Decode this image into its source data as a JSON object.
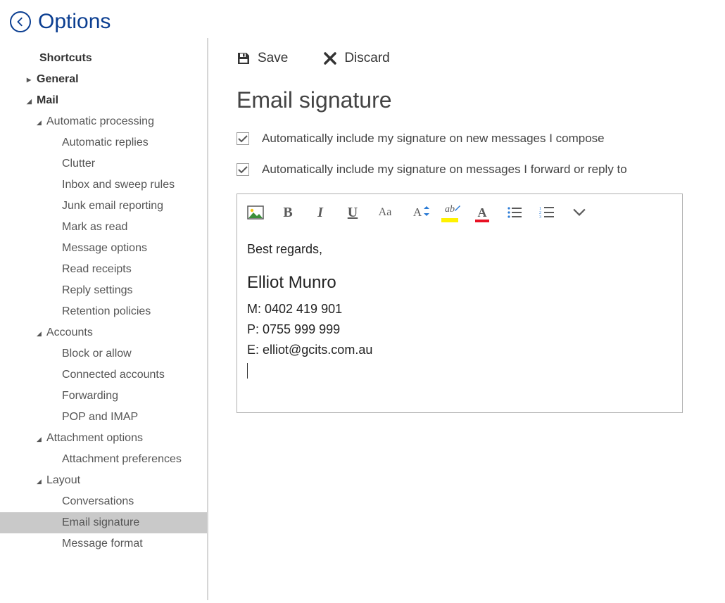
{
  "header": {
    "title": "Options"
  },
  "toolbar": {
    "save": "Save",
    "discard": "Discard"
  },
  "section": {
    "heading": "Email signature"
  },
  "checkboxes": {
    "compose": "Automatically include my signature on new messages I compose",
    "reply": "Automatically include my signature on messages I forward or reply to"
  },
  "signature": {
    "greeting": "Best regards,",
    "name": "Elliot Munro",
    "mobile": "M: 0402 419 901",
    "phone": "P: 0755 999 999",
    "email": "E: elliot@gcits.com.au"
  },
  "sidebar": {
    "shortcuts": "Shortcuts",
    "general": "General",
    "mail": "Mail",
    "autoproc": "Automatic processing",
    "autoreplies": "Automatic replies",
    "clutter": "Clutter",
    "inboxrules": "Inbox and sweep rules",
    "junk": "Junk email reporting",
    "markread": "Mark as read",
    "msgoptions": "Message options",
    "readreceipts": "Read receipts",
    "replysettings": "Reply settings",
    "retention": "Retention policies",
    "accounts": "Accounts",
    "blockallow": "Block or allow",
    "connected": "Connected accounts",
    "forwarding": "Forwarding",
    "popimap": "POP and IMAP",
    "attachopts": "Attachment options",
    "attachprefs": "Attachment preferences",
    "layout": "Layout",
    "conversations": "Conversations",
    "emailsig": "Email signature",
    "msgformat": "Message format"
  },
  "editor_buttons": {
    "image": "image",
    "bold": "B",
    "italic": "I",
    "underline": "U",
    "fontname": "Aa",
    "fontsize": "A",
    "highlight": "ab",
    "fontcolor": "A",
    "bullets": "bullets",
    "numbering": "numbering",
    "more": "more"
  }
}
